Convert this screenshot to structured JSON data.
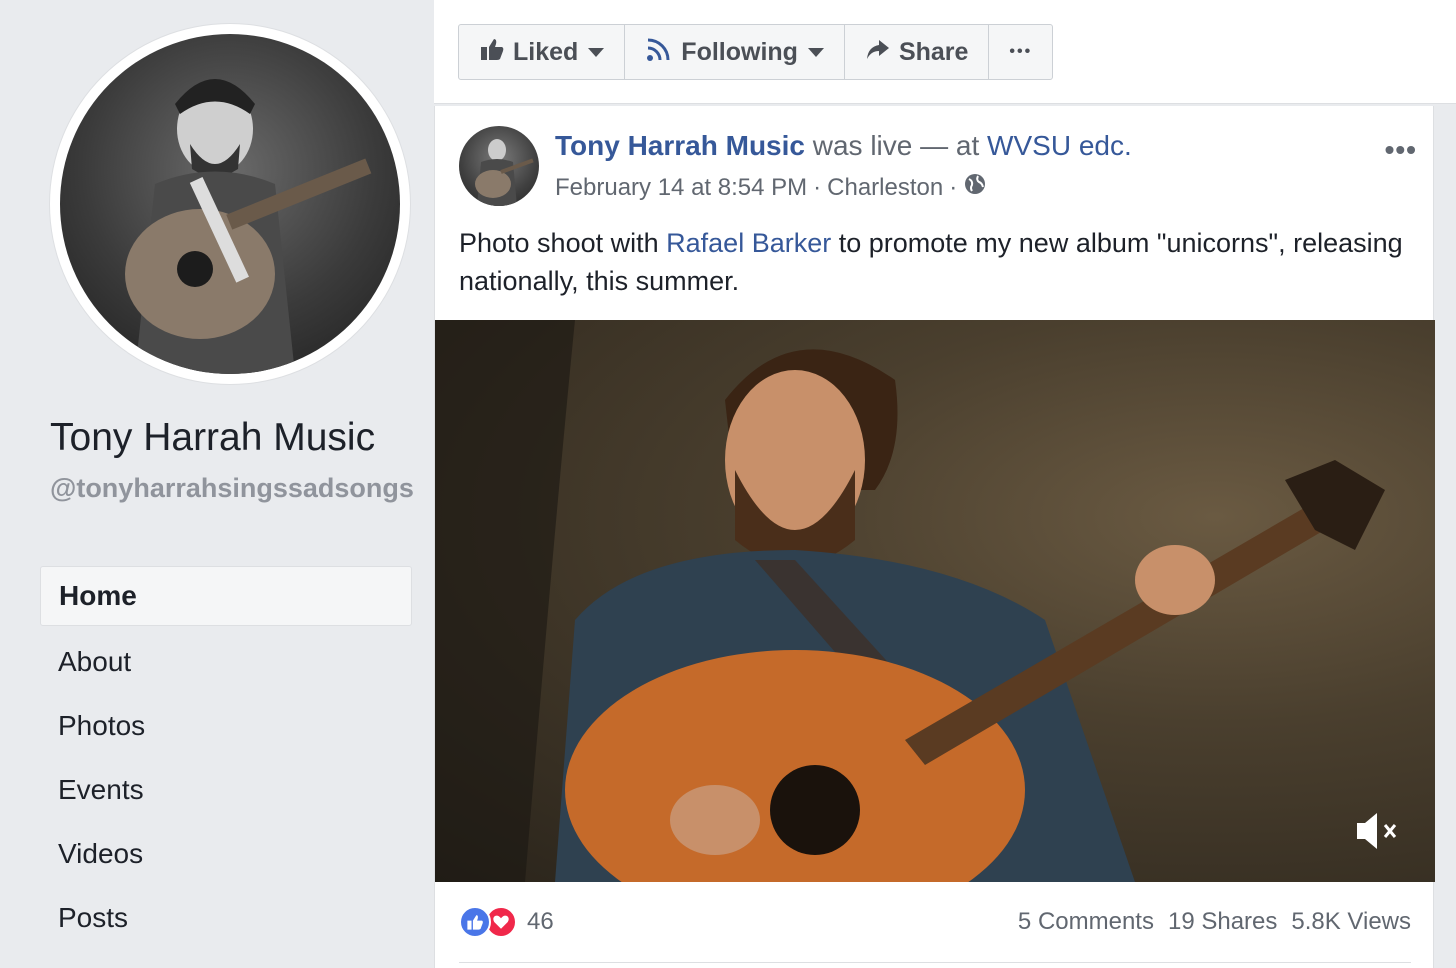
{
  "sidebar": {
    "page_name": "Tony Harrah Music",
    "handle": "@tonyharrahsingssadsongs",
    "nav": [
      {
        "label": "Home",
        "active": true
      },
      {
        "label": "About",
        "active": false
      },
      {
        "label": "Photos",
        "active": false
      },
      {
        "label": "Events",
        "active": false
      },
      {
        "label": "Videos",
        "active": false
      },
      {
        "label": "Posts",
        "active": false
      }
    ]
  },
  "toolbar": {
    "liked_label": "Liked",
    "following_label": "Following",
    "share_label": "Share",
    "more_label": "•••"
  },
  "post": {
    "author": "Tony Harrah Music",
    "status_text": "was live — at",
    "location_link": "WVSU edc.",
    "date": "February 14 at 8:54 PM",
    "separator": "·",
    "place": "Charleston",
    "more_label": "•••",
    "text_before": "Photo shoot with ",
    "mention": "Rafael Barker",
    "text_after": " to promote my new album \"unicorns\", releasing nationally, this summer."
  },
  "footer": {
    "reaction_count": "46",
    "comments": "5 Comments",
    "shares": "19 Shares",
    "views": "5.8K Views"
  },
  "colors": {
    "link": "#365899",
    "like": "#4a76e8",
    "love": "#f0284a"
  }
}
